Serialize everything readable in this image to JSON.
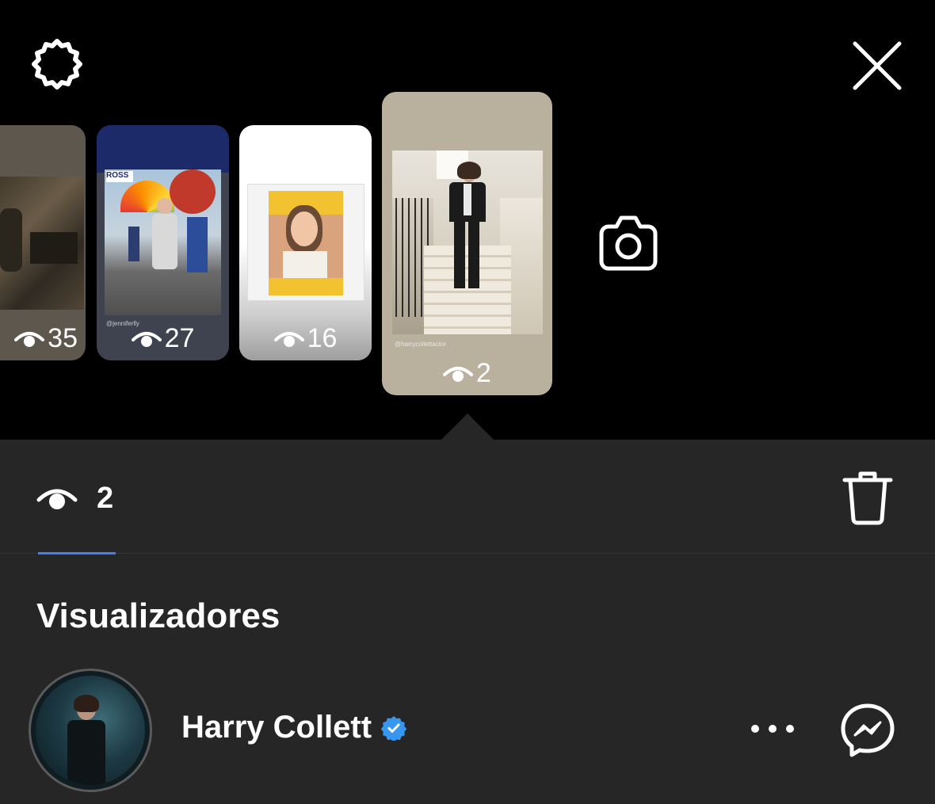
{
  "header": {
    "settings_icon": "gear-icon",
    "close_icon": "close-icon"
  },
  "stories": [
    {
      "views": "35",
      "handle": ""
    },
    {
      "views": "27",
      "handle": "@jenniferlly"
    },
    {
      "views": "16",
      "handle": ""
    },
    {
      "views": "2",
      "handle": "@harrycollettactor"
    }
  ],
  "camera_icon": "camera-icon",
  "viewers_panel": {
    "view_count": "2",
    "delete_icon": "trash-icon",
    "accent_color": "#3b82f6",
    "section_title": "Visualizadores",
    "viewers": [
      {
        "name": "Harry Collett",
        "verified": true
      }
    ]
  }
}
